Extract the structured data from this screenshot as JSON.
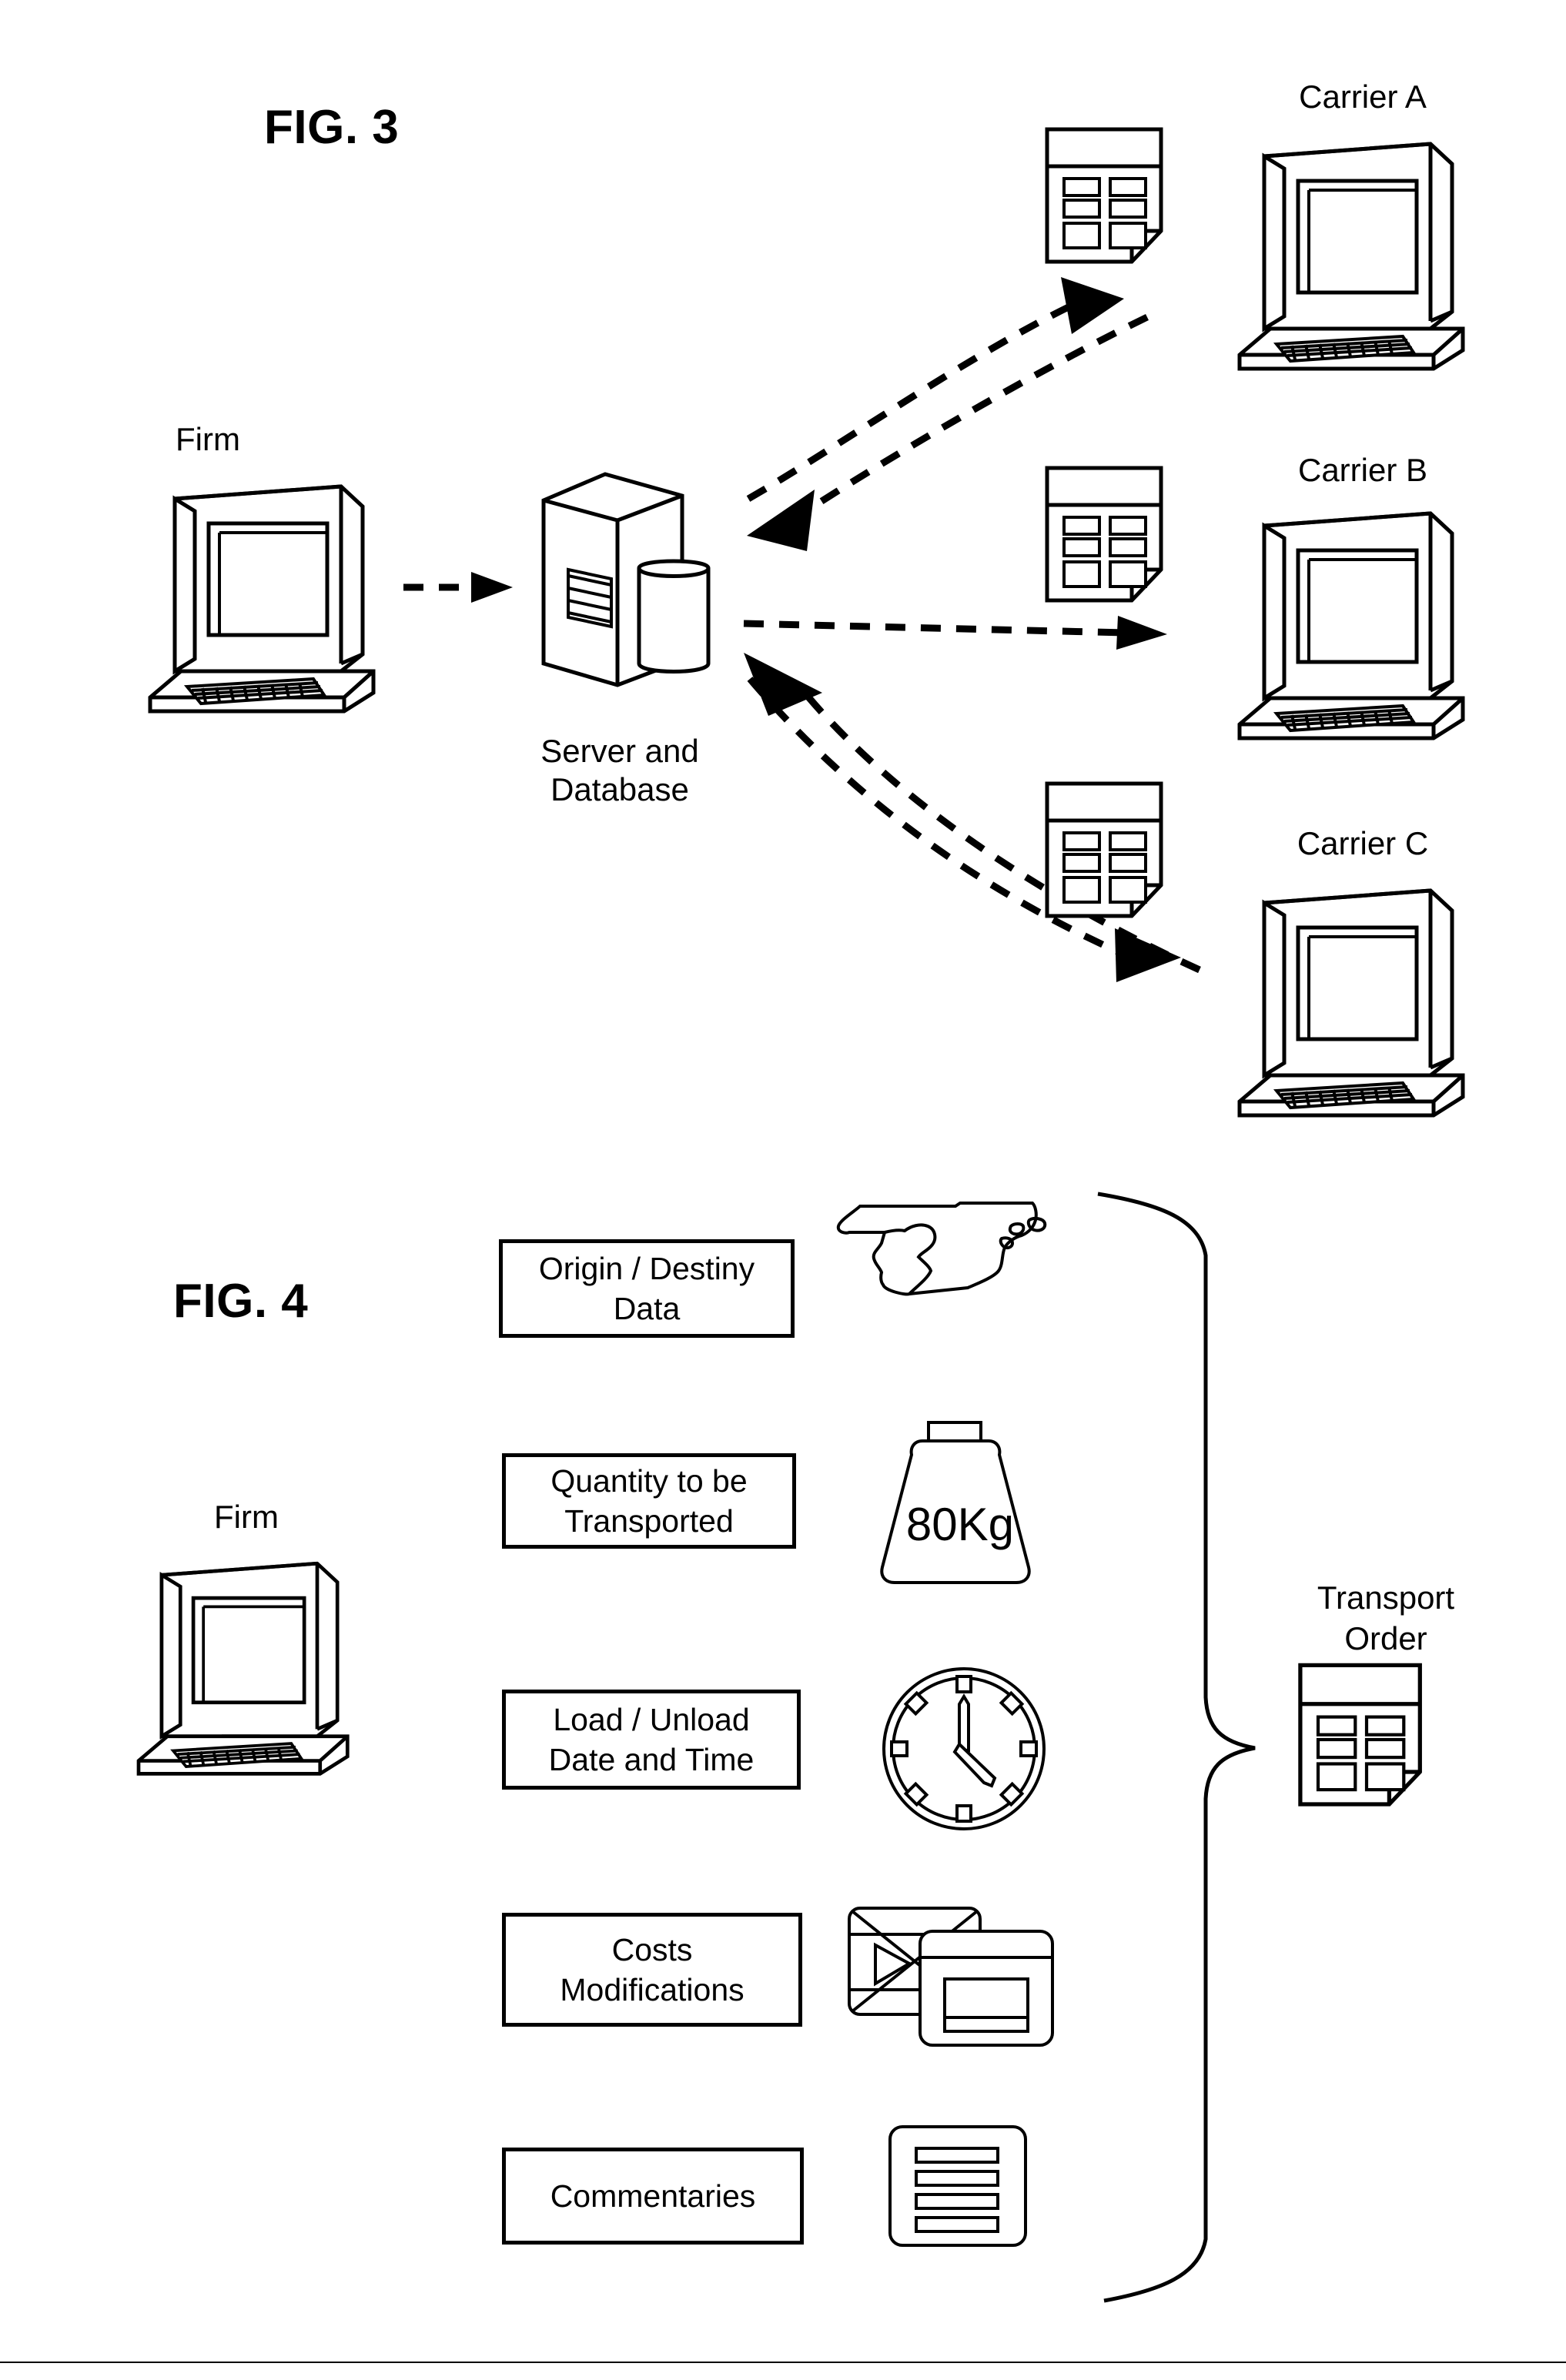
{
  "figures": [
    {
      "id": "fig3",
      "title": "FIG. 3",
      "nodes": {
        "firm": "Firm",
        "server": "Server and\nDatabase",
        "server_line1": "Server and",
        "server_line2": "Database",
        "carrier_a": "Carrier A",
        "carrier_b": "Carrier B",
        "carrier_c": "Carrier C"
      },
      "icons": {
        "firm": "desktop-computer-icon",
        "server": "server-tower-icon",
        "database": "database-cylinder-icon",
        "document_a": "transport-order-document-icon",
        "document_b": "transport-order-document-icon",
        "document_c": "transport-order-document-icon",
        "carrier_a": "desktop-computer-icon",
        "carrier_b": "desktop-computer-icon",
        "carrier_c": "desktop-computer-icon"
      },
      "connectors": [
        {
          "name": "firm-to-server",
          "style": "dashed-arrow",
          "direction": "right"
        },
        {
          "name": "server-to-carrier-a",
          "style": "dashed-arrow-curved",
          "direction": "up-right"
        },
        {
          "name": "carrier-a-to-server",
          "style": "dashed-arrow-curved",
          "direction": "down-left"
        },
        {
          "name": "server-to-carrier-b",
          "style": "dashed-arrow",
          "direction": "right"
        },
        {
          "name": "server-to-carrier-c",
          "style": "dashed-arrow-curved",
          "direction": "down-right"
        },
        {
          "name": "carrier-c-to-server",
          "style": "dashed-arrow-curved",
          "direction": "up-left"
        }
      ]
    },
    {
      "id": "fig4",
      "title": "FIG. 4",
      "nodes": {
        "firm": "Firm",
        "transport_order": "Transport\nOrder",
        "transport_order_line1": "Transport",
        "transport_order_line2": "Order"
      },
      "icons": {
        "firm": "desktop-computer-icon",
        "transport_order": "transport-order-document-icon",
        "brace": "curly-brace-right-icon"
      },
      "rows": [
        {
          "box_line1": "Origin / Destiny",
          "box_line2": "Data",
          "icon": "map-spain-icon",
          "icon_label": ""
        },
        {
          "box_line1": "Quantity to be",
          "box_line2": "Transported",
          "icon": "weight-icon",
          "icon_label": "80Kg"
        },
        {
          "box_line1": "Load / Unload",
          "box_line2": "Date and Time",
          "icon": "clock-icon",
          "icon_label": ""
        },
        {
          "box_line1": "Costs",
          "box_line2": "Modifications",
          "icon": "cards-stack-icon",
          "icon_label": ""
        },
        {
          "box_line1": "Commentaries",
          "box_line2": "",
          "icon": "text-lines-card-icon",
          "icon_label": ""
        }
      ]
    }
  ],
  "colors": {
    "ink": "#000000",
    "paper": "#ffffff"
  }
}
